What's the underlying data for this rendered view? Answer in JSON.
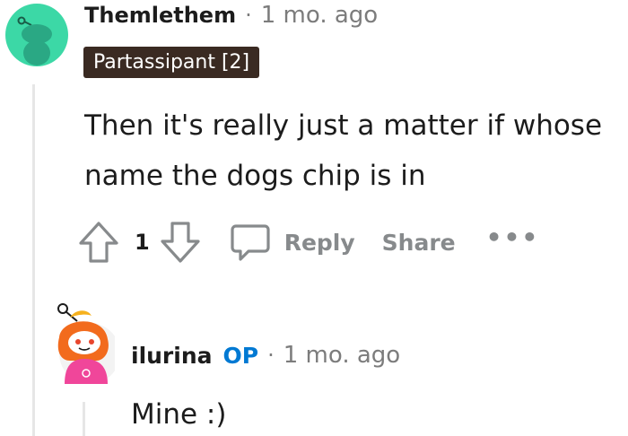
{
  "comment1": {
    "username": "Themlethem",
    "separator": "·",
    "time": "1 mo. ago",
    "flair": "Partassipant [2]",
    "body_lines": [
      "Then it's really just a matter if whose",
      "name the dogs chip is in"
    ],
    "votes": "1",
    "reply_label": "Reply",
    "share_label": "Share",
    "more_label": "•••",
    "icons": {
      "upvote": "upvote-arrow-icon",
      "downvote": "downvote-arrow-icon",
      "reply": "comment-bubble-icon",
      "avatar": "reddit-snoo-avatar-teal"
    }
  },
  "comment2": {
    "username": "ilurina",
    "op_badge": "OP",
    "separator": "·",
    "time": "1 mo. ago",
    "body": "Mine :)",
    "icons": {
      "avatar": "reddit-snoo-avatar-orange-pink"
    }
  },
  "colors": {
    "flair_bg": "#3a2a22",
    "op_blue": "#0079d3",
    "meta_gray": "#7c7c7c",
    "action_gray": "#878a8c",
    "avatar1_bg": "#3cd8a6",
    "thread_line": "#e6e6e6"
  }
}
